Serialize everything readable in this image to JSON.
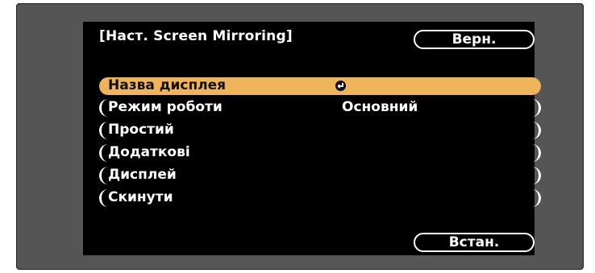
{
  "menu": {
    "title": "[Наст. Screen Mirroring]",
    "back_label": "Верн.",
    "set_label": "Встан.",
    "items": [
      {
        "label": "Назва дисплея",
        "value": "",
        "selected": true,
        "icon": "enter-icon"
      },
      {
        "label": "Режим роботи",
        "value": "Основний",
        "selected": false
      },
      {
        "label": "Простий",
        "value": "",
        "selected": false
      },
      {
        "label": "Додаткові",
        "value": "",
        "selected": false
      },
      {
        "label": "Дисплей",
        "value": "",
        "selected": false
      },
      {
        "label": "Скинути",
        "value": "",
        "selected": false
      }
    ]
  },
  "colors": {
    "frame": "#555555",
    "panel": "#000000",
    "highlight": "#f0b45a",
    "text": "#ffffff"
  }
}
